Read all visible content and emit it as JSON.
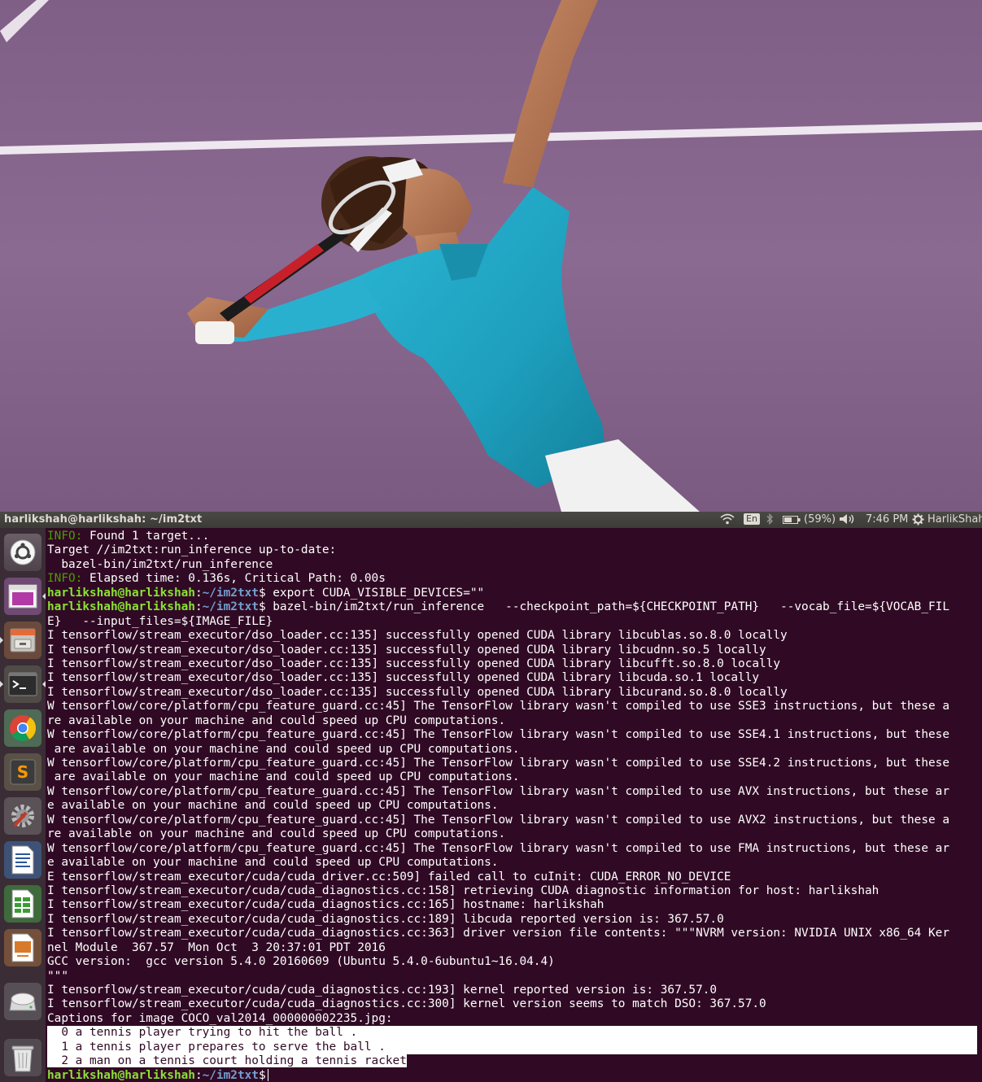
{
  "panel": {
    "window_title": "harlikshah@harlikshah: ~/im2txt",
    "keyboard_layout": "En",
    "battery": "(59%)",
    "clock": "7:46 PM",
    "user": "HarlikShah"
  },
  "launcher": {
    "items": [
      {
        "name": "dash",
        "icon": "ubuntu-logo-icon"
      },
      {
        "name": "image-viewer",
        "icon": "image-viewer-icon"
      },
      {
        "name": "files",
        "icon": "file-cabinet-icon"
      },
      {
        "name": "terminal",
        "icon": "terminal-icon"
      },
      {
        "name": "chrome",
        "icon": "chrome-icon"
      },
      {
        "name": "sublime-text",
        "icon": "sublime-text-icon"
      },
      {
        "name": "system-settings",
        "icon": "settings-icon"
      },
      {
        "name": "libreoffice-writer",
        "icon": "writer-icon"
      },
      {
        "name": "libreoffice-calc",
        "icon": "calc-icon"
      },
      {
        "name": "libreoffice-impress",
        "icon": "impress-icon"
      },
      {
        "name": "drive",
        "icon": "drive-icon"
      },
      {
        "name": "trash",
        "icon": "trash-icon"
      }
    ]
  },
  "terminal": {
    "prompt_user": "harlikshah@harlikshah",
    "prompt_path": "~/im2txt",
    "lines": [
      {
        "segments": [
          {
            "c": "g2",
            "t": "INFO:"
          },
          {
            "c": "",
            "t": " Found 1 target..."
          }
        ]
      },
      {
        "segments": [
          {
            "c": "",
            "t": "Target //im2txt:run_inference up-to-date:"
          }
        ]
      },
      {
        "segments": [
          {
            "c": "",
            "t": "  bazel-bin/im2txt/run_inference"
          }
        ]
      },
      {
        "segments": [
          {
            "c": "g2",
            "t": "INFO:"
          },
          {
            "c": "",
            "t": " Elapsed time: 0.136s, Critical Path: 0.00s"
          }
        ]
      },
      {
        "segments": [
          {
            "c": "g",
            "t": "harlikshah@harlikshah"
          },
          {
            "c": "",
            "t": ":"
          },
          {
            "c": "b",
            "t": "~/im2txt"
          },
          {
            "c": "",
            "t": "$ export CUDA_VISIBLE_DEVICES=\"\""
          }
        ]
      },
      {
        "segments": [
          {
            "c": "g",
            "t": "harlikshah@harlikshah"
          },
          {
            "c": "",
            "t": ":"
          },
          {
            "c": "b",
            "t": "~/im2txt"
          },
          {
            "c": "",
            "t": "$ bazel-bin/im2txt/run_inference   --checkpoint_path=${CHECKPOINT_PATH}   --vocab_file=${VOCAB_FIL"
          }
        ]
      },
      {
        "segments": [
          {
            "c": "",
            "t": "E}   --input_files=${IMAGE_FILE}"
          }
        ]
      },
      {
        "segments": [
          {
            "c": "",
            "t": "I tensorflow/stream_executor/dso_loader.cc:135] successfully opened CUDA library libcublas.so.8.0 locally"
          }
        ]
      },
      {
        "segments": [
          {
            "c": "",
            "t": "I tensorflow/stream_executor/dso_loader.cc:135] successfully opened CUDA library libcudnn.so.5 locally"
          }
        ]
      },
      {
        "segments": [
          {
            "c": "",
            "t": "I tensorflow/stream_executor/dso_loader.cc:135] successfully opened CUDA library libcufft.so.8.0 locally"
          }
        ]
      },
      {
        "segments": [
          {
            "c": "",
            "t": "I tensorflow/stream_executor/dso_loader.cc:135] successfully opened CUDA library libcuda.so.1 locally"
          }
        ]
      },
      {
        "segments": [
          {
            "c": "",
            "t": "I tensorflow/stream_executor/dso_loader.cc:135] successfully opened CUDA library libcurand.so.8.0 locally"
          }
        ]
      },
      {
        "segments": [
          {
            "c": "",
            "t": "W tensorflow/core/platform/cpu_feature_guard.cc:45] The TensorFlow library wasn't compiled to use SSE3 instructions, but these a"
          }
        ]
      },
      {
        "segments": [
          {
            "c": "",
            "t": "re available on your machine and could speed up CPU computations."
          }
        ]
      },
      {
        "segments": [
          {
            "c": "",
            "t": "W tensorflow/core/platform/cpu_feature_guard.cc:45] The TensorFlow library wasn't compiled to use SSE4.1 instructions, but these"
          }
        ]
      },
      {
        "segments": [
          {
            "c": "",
            "t": " are available on your machine and could speed up CPU computations."
          }
        ]
      },
      {
        "segments": [
          {
            "c": "",
            "t": "W tensorflow/core/platform/cpu_feature_guard.cc:45] The TensorFlow library wasn't compiled to use SSE4.2 instructions, but these"
          }
        ]
      },
      {
        "segments": [
          {
            "c": "",
            "t": " are available on your machine and could speed up CPU computations."
          }
        ]
      },
      {
        "segments": [
          {
            "c": "",
            "t": "W tensorflow/core/platform/cpu_feature_guard.cc:45] The TensorFlow library wasn't compiled to use AVX instructions, but these ar"
          }
        ]
      },
      {
        "segments": [
          {
            "c": "",
            "t": "e available on your machine and could speed up CPU computations."
          }
        ]
      },
      {
        "segments": [
          {
            "c": "",
            "t": "W tensorflow/core/platform/cpu_feature_guard.cc:45] The TensorFlow library wasn't compiled to use AVX2 instructions, but these a"
          }
        ]
      },
      {
        "segments": [
          {
            "c": "",
            "t": "re available on your machine and could speed up CPU computations."
          }
        ]
      },
      {
        "segments": [
          {
            "c": "",
            "t": "W tensorflow/core/platform/cpu_feature_guard.cc:45] The TensorFlow library wasn't compiled to use FMA instructions, but these ar"
          }
        ]
      },
      {
        "segments": [
          {
            "c": "",
            "t": "e available on your machine and could speed up CPU computations."
          }
        ]
      },
      {
        "segments": [
          {
            "c": "",
            "t": "E tensorflow/stream_executor/cuda/cuda_driver.cc:509] failed call to cuInit: CUDA_ERROR_NO_DEVICE"
          }
        ]
      },
      {
        "segments": [
          {
            "c": "",
            "t": "I tensorflow/stream_executor/cuda/cuda_diagnostics.cc:158] retrieving CUDA diagnostic information for host: harlikshah"
          }
        ]
      },
      {
        "segments": [
          {
            "c": "",
            "t": "I tensorflow/stream_executor/cuda/cuda_diagnostics.cc:165] hostname: harlikshah"
          }
        ]
      },
      {
        "segments": [
          {
            "c": "",
            "t": "I tensorflow/stream_executor/cuda/cuda_diagnostics.cc:189] libcuda reported version is: 367.57.0"
          }
        ]
      },
      {
        "segments": [
          {
            "c": "",
            "t": "I tensorflow/stream_executor/cuda/cuda_diagnostics.cc:363] driver version file contents: \"\"\"NVRM version: NVIDIA UNIX x86_64 Ker"
          }
        ]
      },
      {
        "segments": [
          {
            "c": "",
            "t": "nel Module  367.57  Mon Oct  3 20:37:01 PDT 2016"
          }
        ]
      },
      {
        "segments": [
          {
            "c": "",
            "t": "GCC version:  gcc version 5.4.0 20160609 (Ubuntu 5.4.0-6ubuntu1~16.04.4)"
          }
        ]
      },
      {
        "segments": [
          {
            "c": "",
            "t": "\"\"\""
          }
        ]
      },
      {
        "segments": [
          {
            "c": "",
            "t": "I tensorflow/stream_executor/cuda/cuda_diagnostics.cc:193] kernel reported version is: 367.57.0"
          }
        ]
      },
      {
        "segments": [
          {
            "c": "",
            "t": "I tensorflow/stream_executor/cuda/cuda_diagnostics.cc:300] kernel version seems to match DSO: 367.57.0"
          }
        ]
      },
      {
        "segments": [
          {
            "c": "",
            "t": "Captions for image COCO_val2014_000000002235.jpg:"
          }
        ]
      },
      {
        "segments": [
          {
            "c": "sel full",
            "t": "  0 a tennis player trying to hit the ball ."
          }
        ]
      },
      {
        "segments": [
          {
            "c": "sel full",
            "t": "  1 a tennis player prepares to serve the ball ."
          }
        ]
      },
      {
        "segments": [
          {
            "c": "sel",
            "t": "  2 a man on a tennis court holding a tennis racket"
          }
        ]
      },
      {
        "segments": [
          {
            "c": "g",
            "t": "harlikshah@harlikshah"
          },
          {
            "c": "",
            "t": ":"
          },
          {
            "c": "b",
            "t": "~/im2txt"
          },
          {
            "c": "",
            "t": "$"
          }
        ],
        "cursor": true
      }
    ]
  },
  "colors": {
    "terminal_bg": "#300a24",
    "prompt_user": "#8ae234",
    "prompt_path": "#729fcf",
    "info_label": "#4e9a06",
    "court": "#84628b",
    "shirt": "#20a7c4"
  }
}
